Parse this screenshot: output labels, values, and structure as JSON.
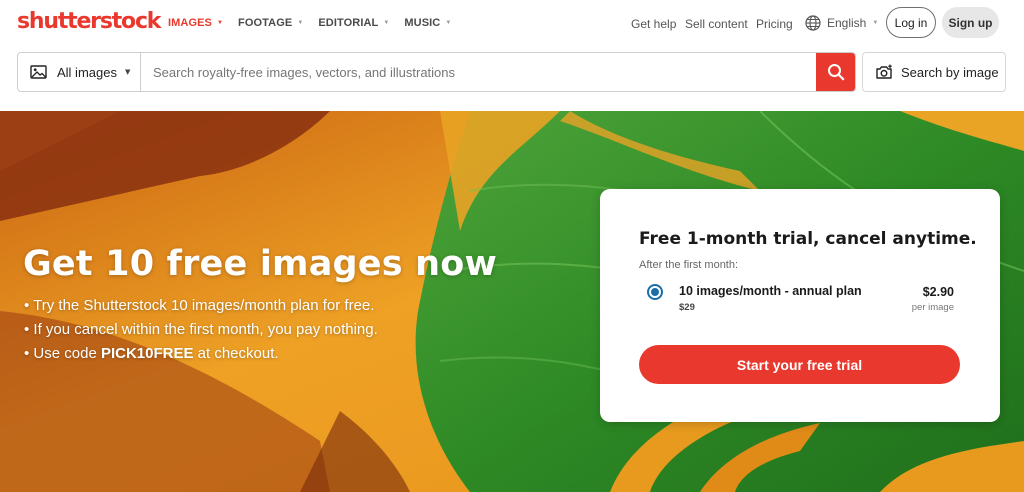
{
  "brand": {
    "logo": "shutterstock",
    "accent": "#e9392e"
  },
  "nav": {
    "items": [
      {
        "label": "IMAGES",
        "active": true
      },
      {
        "label": "FOOTAGE",
        "active": false
      },
      {
        "label": "EDITORIAL",
        "active": false
      },
      {
        "label": "MUSIC",
        "active": false
      }
    ],
    "get_help": "Get help",
    "sell_content": "Sell content",
    "pricing": "Pricing",
    "language": "English",
    "login": "Log in",
    "signup": "Sign up"
  },
  "search": {
    "scope": "All images",
    "placeholder": "Search royalty-free images, vectors, and illustrations",
    "value": "",
    "search_by_image": "Search by image"
  },
  "hero": {
    "title": "Get 10 free images now",
    "bullets": [
      "• Try the Shutterstock 10 images/month plan for free.",
      "• If you cancel within the first month, you pay nothing.",
      "• Use code "
    ],
    "promo_code": "PICK10FREE",
    "promo_suffix": " at checkout."
  },
  "trial_card": {
    "title": "Free 1-month trial, cancel anytime.",
    "subtitle": "After the first month:",
    "plan_name": "10 images/month - annual plan",
    "plan_monthly": "$29",
    "plan_price": "$2.90",
    "plan_per": "per image",
    "cta": "Start your free trial"
  },
  "colors": {
    "hero_orange": "#e99a1c",
    "leaf_green": "#2f8a25",
    "radio_blue": "#1c6ea8"
  }
}
